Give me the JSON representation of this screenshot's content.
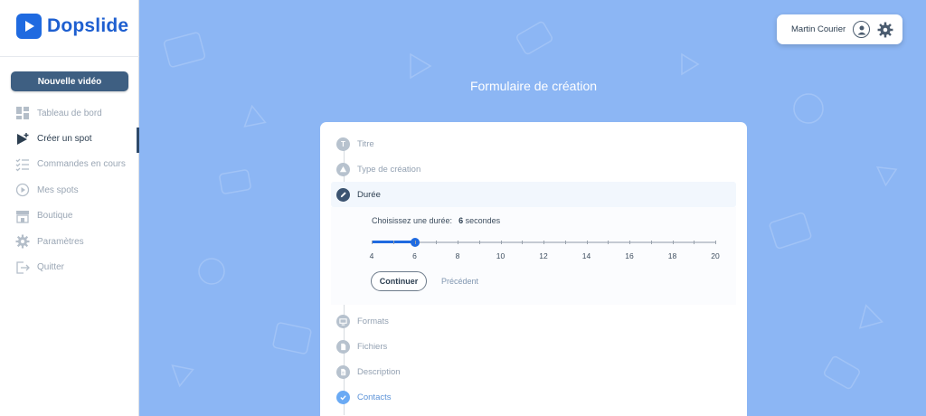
{
  "app": {
    "name": "Dopslide"
  },
  "sidebar": {
    "new_video_label": "Nouvelle vidéo",
    "items": [
      {
        "label": "Tableau de bord",
        "icon": "dashboard-icon"
      },
      {
        "label": "Créer un spot",
        "icon": "create-spot-icon",
        "active": true
      },
      {
        "label": "Commandes en cours",
        "icon": "checklist-icon"
      },
      {
        "label": "Mes spots",
        "icon": "play-circle-icon"
      },
      {
        "label": "Boutique",
        "icon": "shop-icon"
      },
      {
        "label": "Paramètres",
        "icon": "gear-icon"
      },
      {
        "label": "Quitter",
        "icon": "logout-icon"
      }
    ]
  },
  "user": {
    "name": "Martin Courier"
  },
  "page": {
    "title": "Formulaire de création"
  },
  "steps": [
    {
      "label": "Titre",
      "status": "pending",
      "badge": "T"
    },
    {
      "label": "Type de création",
      "status": "pending"
    },
    {
      "label": "Durée",
      "status": "active"
    },
    {
      "label": "Formats",
      "status": "pending"
    },
    {
      "label": "Fichiers",
      "status": "pending"
    },
    {
      "label": "Description",
      "status": "pending"
    },
    {
      "label": "Contacts",
      "status": "done"
    }
  ],
  "duration": {
    "prompt": "Choisissez une durée:",
    "value": "6",
    "unit": "secondes",
    "min": 4,
    "max": 20,
    "current": 6,
    "tick_labels": [
      "4",
      "6",
      "8",
      "10",
      "12",
      "14",
      "16",
      "18",
      "20"
    ],
    "continue_label": "Continuer",
    "previous_label": "Précédent"
  },
  "colors": {
    "accent": "#1f6ae0",
    "background": "#8cb6f4",
    "sidebar_button": "#3e5f82"
  }
}
